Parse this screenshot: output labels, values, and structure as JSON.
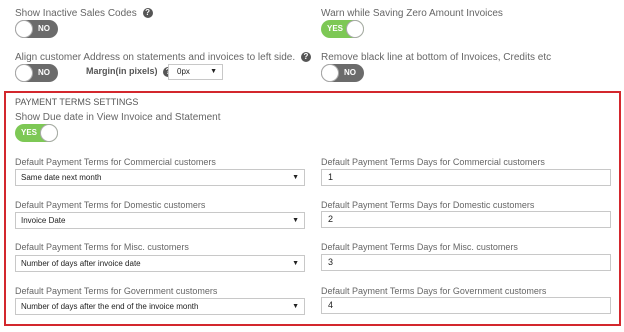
{
  "top": {
    "show_inactive": {
      "label": "Show Inactive Sales Codes",
      "toggle": "NO"
    },
    "warn_zero": {
      "label": "Warn while Saving Zero Amount Invoices",
      "toggle": "YES"
    },
    "align_address": {
      "label": "Align customer Address on statements and invoices to left side.",
      "toggle": "NO"
    },
    "margin": {
      "label": "Margin(in pixels)",
      "value": "0px"
    },
    "remove_black_line": {
      "label": "Remove black line at bottom of Invoices, Credits etc",
      "toggle": "NO"
    }
  },
  "payment_terms": {
    "title": "PAYMENT TERMS SETTINGS",
    "show_due_date": {
      "label": "Show Due date in View Invoice and Statement",
      "toggle": "YES"
    },
    "rows": [
      {
        "terms_label": "Default Payment Terms for Commercial customers",
        "terms_value": "Same date next month",
        "days_label": "Default Payment Terms Days for Commercial customers",
        "days_value": "1"
      },
      {
        "terms_label": "Default Payment Terms for Domestic customers",
        "terms_value": "Invoice Date",
        "days_label": "Default Payment Terms Days for Domestic customers",
        "days_value": "2"
      },
      {
        "terms_label": "Default Payment Terms for Misc. customers",
        "terms_value": "Number of days after invoice date",
        "days_label": "Default Payment Terms Days for Misc. customers",
        "days_value": "3"
      },
      {
        "terms_label": "Default Payment Terms for Government customers",
        "terms_value": "Number of days after the end of the invoice month",
        "days_label": "Default Payment Terms Days for Government customers",
        "days_value": "4"
      }
    ]
  },
  "icons": {
    "help": "question-mark-circle-icon",
    "dropdown": "caret-down-icon"
  },
  "colors": {
    "toggle_on": "#7dc855",
    "toggle_off": "#6b6b6b",
    "panel_border": "#d3272d"
  },
  "glyphs": {
    "help": "?",
    "caret": "▼"
  }
}
